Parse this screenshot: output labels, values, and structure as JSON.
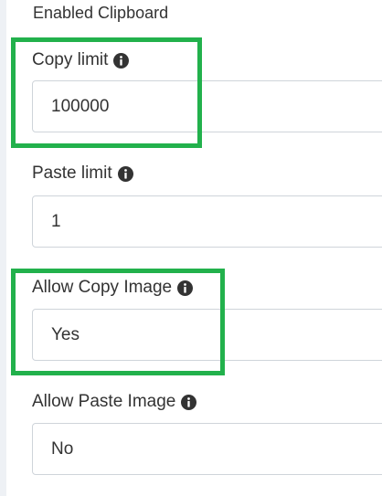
{
  "section": {
    "title": "Enabled Clipboard"
  },
  "fields": [
    {
      "label": "Copy limit",
      "value": "100000",
      "info_icon": "info-circle-icon"
    },
    {
      "label": "Paste limit",
      "value": "1",
      "info_icon": "info-circle-icon"
    },
    {
      "label": "Allow Copy Image",
      "value": "Yes",
      "info_icon": "info-circle-icon"
    },
    {
      "label": "Allow Paste Image",
      "value": "No",
      "info_icon": "info-circle-icon"
    }
  ],
  "colors": {
    "highlight": "#22b14c",
    "text": "#333333",
    "border": "#cfd4da"
  }
}
